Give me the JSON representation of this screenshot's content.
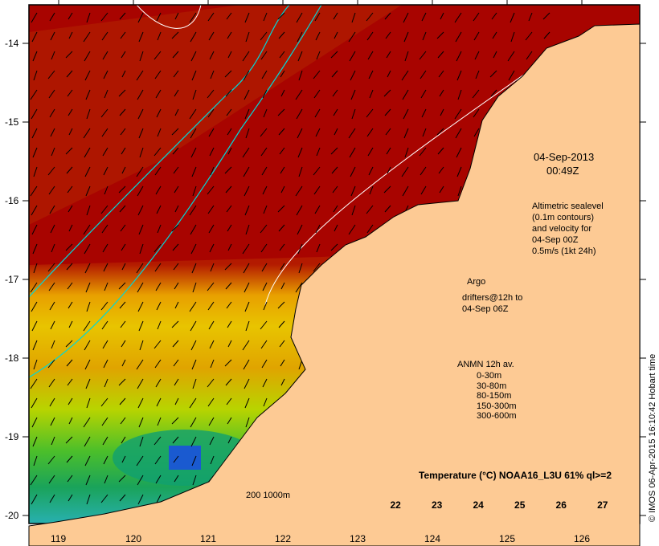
{
  "map": {
    "date": "04-Sep-2013",
    "time": "00:49Z",
    "altimetry": [
      "Altimetric sealevel",
      "(0.1m contours)",
      "and velocity for",
      "04-Sep 00Z",
      "0.5m/s (1kt 24h)"
    ],
    "argo_label": "Argo",
    "drifters": [
      "drifters@12h to",
      "04-Sep 06Z"
    ],
    "scale_label": "200  1000m",
    "anmn": {
      "title": "ANMN 12h av.",
      "items": [
        {
          "label": "0-30m",
          "color": "#000000"
        },
        {
          "label": "30-80m",
          "color": "#0000ff"
        },
        {
          "label": "80-150m",
          "color": "#00ffff"
        },
        {
          "label": "150-300m",
          "color": "#ff0000"
        },
        {
          "label": "300-600m",
          "color": "#ff00ff"
        }
      ]
    },
    "colorbar": {
      "title": "Temperature (°C) NOAA16_L3U 61% ql>=2",
      "ticks": [
        "22",
        "23",
        "24",
        "25",
        "26",
        "27"
      ],
      "range": [
        21.7,
        27.6
      ]
    },
    "lon_ticks": [
      "119",
      "120",
      "121",
      "122",
      "123",
      "124",
      "125",
      "126"
    ],
    "lat_ticks": [
      "-14",
      "-15",
      "-16",
      "-17",
      "-18",
      "-19",
      "-20"
    ],
    "stamp": "© IMOS 06-Apr-2015 16:10:42 Hobart time",
    "colors": {
      "land": "#fdca94",
      "warm": "#a50000",
      "argo": "#ff00ff"
    }
  }
}
